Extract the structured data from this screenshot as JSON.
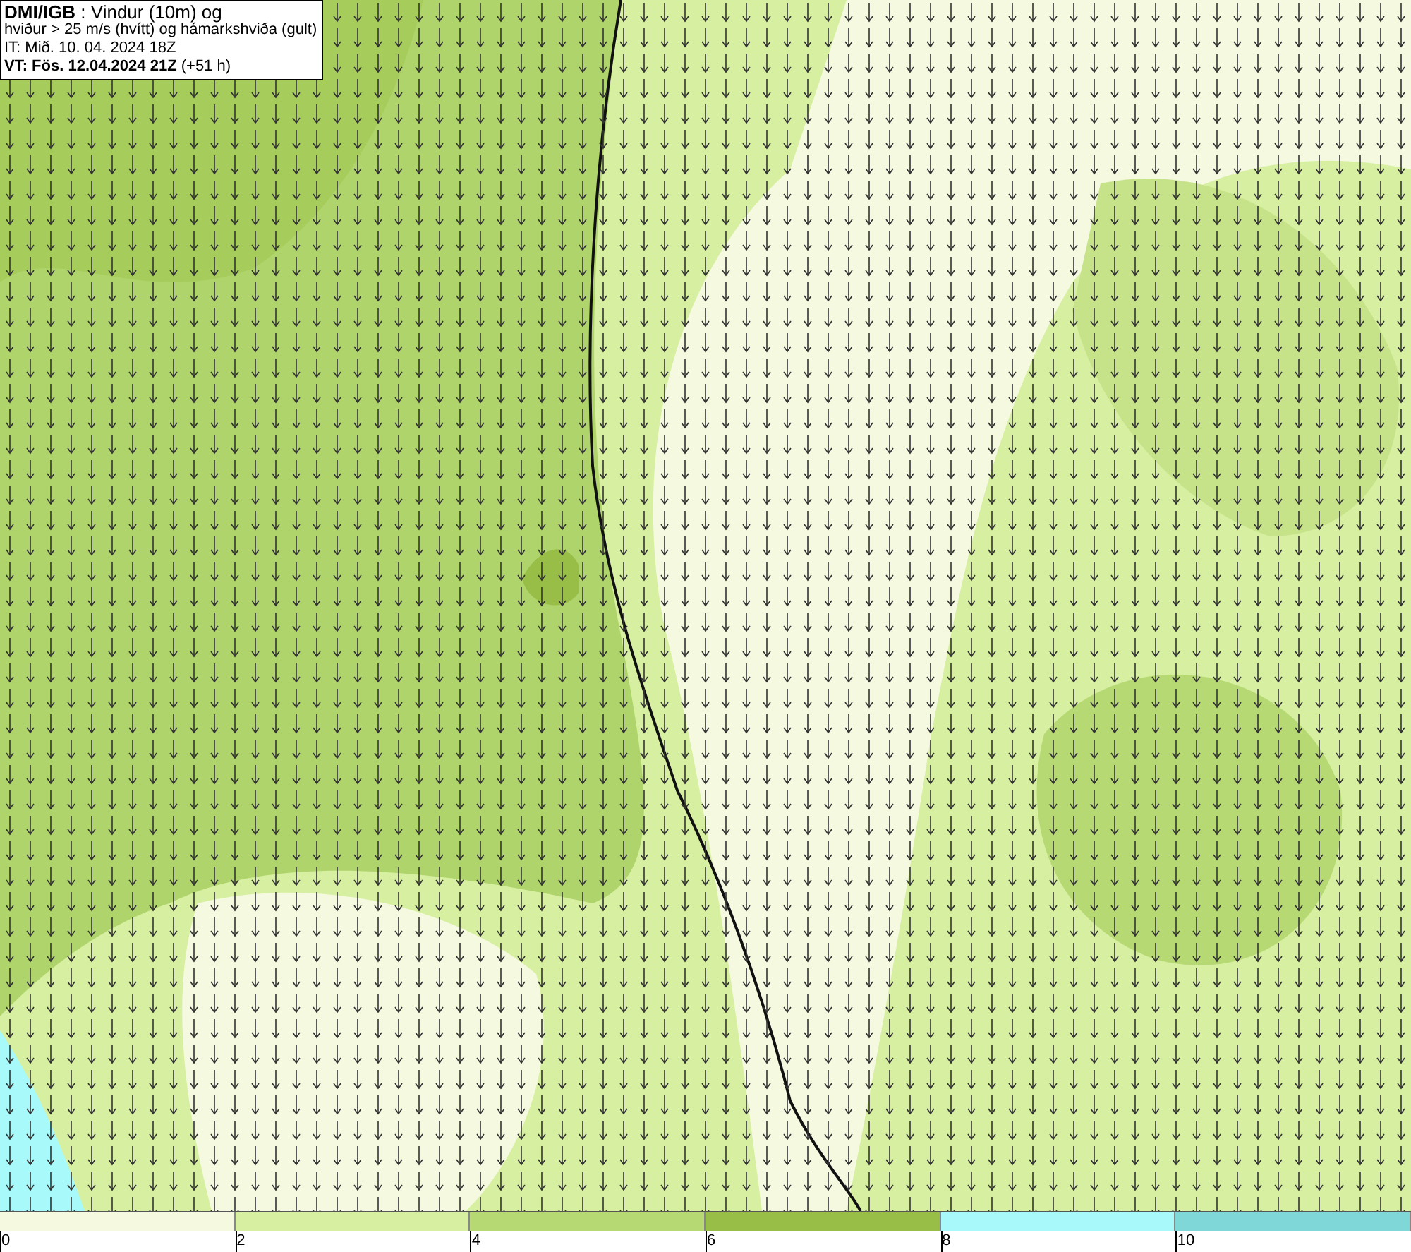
{
  "title_box": {
    "lines": [
      "**DMI/IGB** : Vindur (10m) og",
      "hviður > 25 m/s (hvítt) og hámarkshviða (gult)",
      "IT: Mið. 10. 04. 2024 18Z",
      "**VT: Fös. 12.04.2024 21Z** (+51 h)"
    ]
  },
  "colorbar": {
    "bins": [
      {
        "color": "#f4f9e0"
      },
      {
        "color": "#d7efa0"
      },
      {
        "color": "#b6d974"
      },
      {
        "color": "#98be48"
      },
      {
        "color": "#a8fafa"
      },
      {
        "color": "#80d7d7"
      }
    ],
    "ticks": [
      "0",
      "2",
      "4",
      "6",
      "8",
      "10"
    ]
  }
}
